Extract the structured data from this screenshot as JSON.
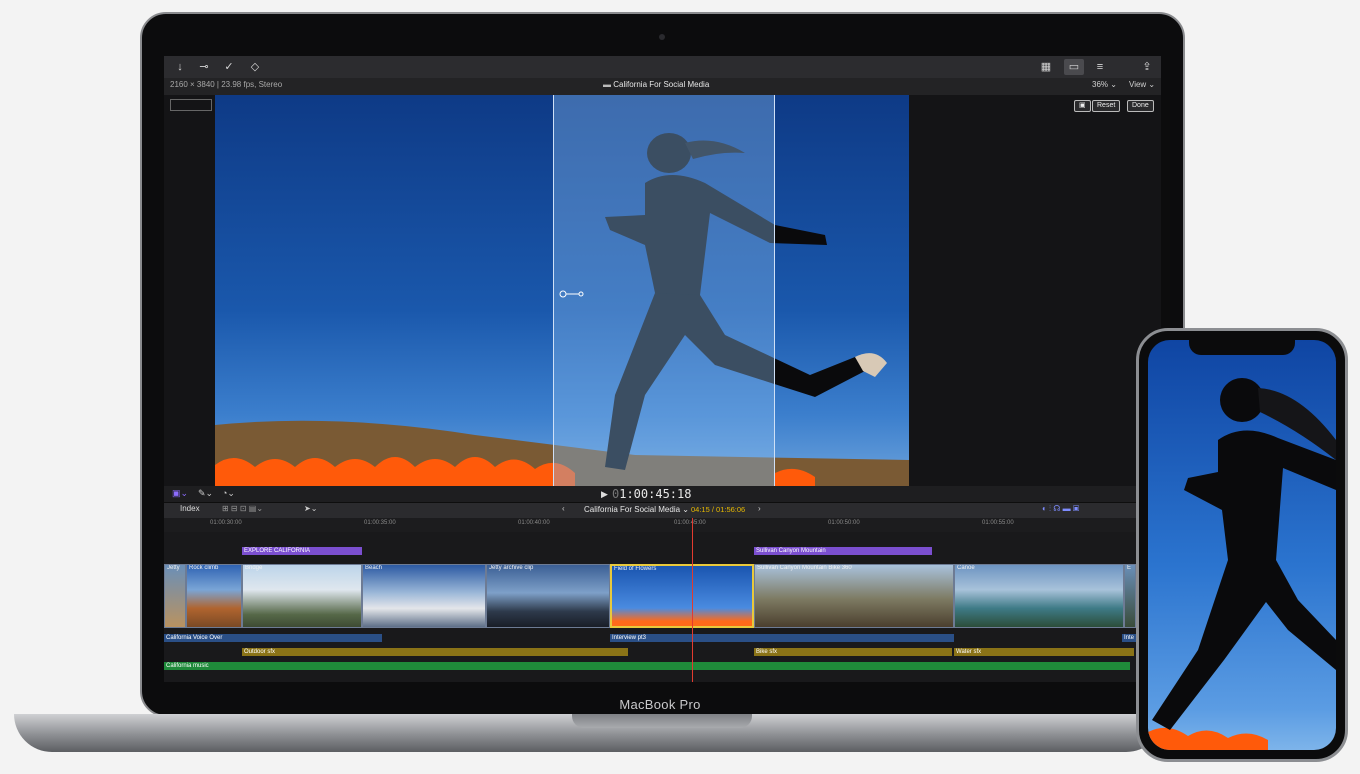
{
  "toolbar": {
    "icons": [
      "import-icon",
      "key-icon",
      "check-icon",
      "tag-icon",
      "browser-icon",
      "timeline-icon",
      "inspector-icon",
      "share-icon"
    ]
  },
  "viewer": {
    "format": "2160 × 3840 | 23.98 fps, Stereo",
    "project_title": "California For Social Media",
    "zoom": "36%",
    "view_label": "View",
    "reset_label": "Reset",
    "done_label": "Done",
    "timecode": "1:00:45:18",
    "timecode_prefix": "0"
  },
  "timeline": {
    "index_label": "Index",
    "project_title": "California For Social Media",
    "duration": "04:15 / 01:56:06",
    "ruler_ticks": [
      "01:00:30:00",
      "01:00:35:00",
      "01:00:40:00",
      "01:00:45:00",
      "01:00:50:00",
      "01:00:55:00"
    ],
    "titles": [
      {
        "label": "EXPLORE CALIFORNIA"
      },
      {
        "label": "Sullivan Canyon Mountain"
      }
    ],
    "clips": [
      {
        "label": "Jetty"
      },
      {
        "label": "Rock climb"
      },
      {
        "label": "Bridge"
      },
      {
        "label": "Beach"
      },
      {
        "label": "Jetty archive clip"
      },
      {
        "label": "Field of Flowers"
      },
      {
        "label": "Sullivan Canyon Mountain Bike 360"
      },
      {
        "label": "Canoe"
      },
      {
        "label": "E"
      }
    ],
    "audio_lanes": [
      {
        "label": "California Voice Over"
      },
      {
        "label": "Interview pt3"
      },
      {
        "label": "Inte"
      },
      {
        "label": "Outdoor sfx"
      },
      {
        "label": "Bike sfx"
      },
      {
        "label": "Water sfx"
      },
      {
        "label": "California music"
      }
    ]
  },
  "device": {
    "laptop_label": "MacBook Pro"
  },
  "colors": {
    "title_purple": "#7b4fd0",
    "voice_blue": "#2a4f86",
    "sfx_gold": "#8a7317",
    "music_green": "#1f8a3a",
    "playhead": "#e23b2f",
    "selection": "#e8c93c"
  }
}
